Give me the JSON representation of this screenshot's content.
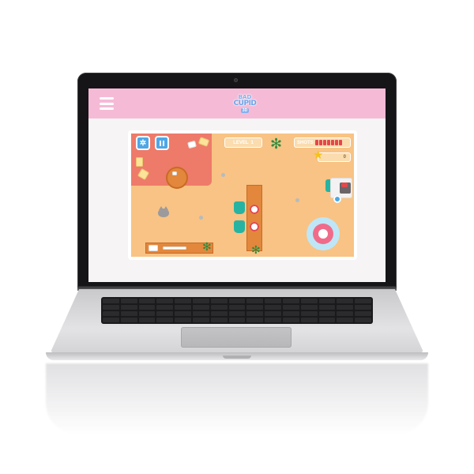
{
  "site": {
    "logo": {
      "line1": "BAD",
      "line2": "CUPID",
      "badge": "3D"
    },
    "menu_icon": "hamburger-menu-icon",
    "header_color": "#f5bad6"
  },
  "game": {
    "settings_icon": "gear-icon",
    "pause_icon": "pause-icon",
    "level_label": "LEVEL",
    "level_value": "1",
    "shots_label": "SHOTS",
    "shots_remaining": 7,
    "score_icon": "star-icon",
    "score_value": "0",
    "colors": {
      "floor": "#f8c384",
      "rug": "#ee7a6a",
      "hud_button": "#4fa7e6",
      "shot": "#e4474b",
      "target_ring": "#f06b8a"
    }
  }
}
